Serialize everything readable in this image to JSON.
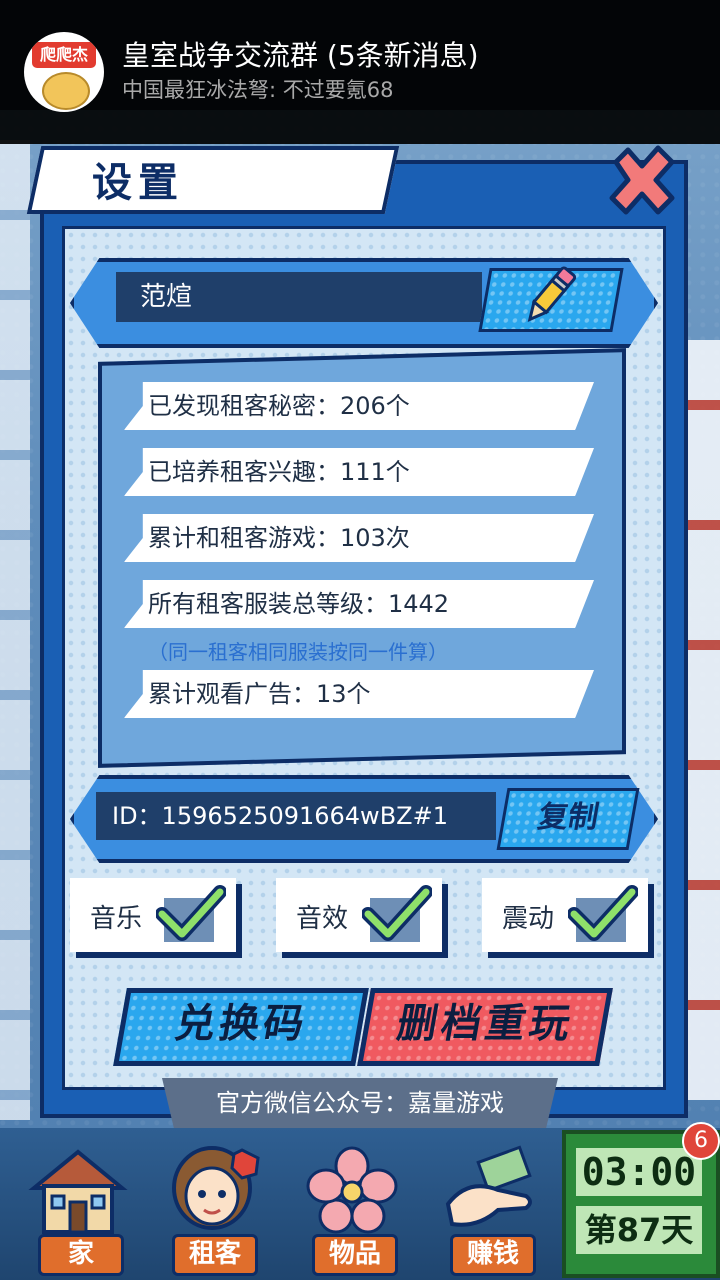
{
  "notification": {
    "avatar_text": "爬爬杰",
    "title": "皇室战争交流群 (5条新消息)",
    "message": "中国最狂冰法弩: 不过要氪68"
  },
  "dialog": {
    "title": "设置",
    "player_name": "范煊",
    "stats": [
      "已发现租客秘密：206个",
      "已培养租客兴趣：111个",
      "累计和租客游戏：103次",
      "所有租客服装总等级：1442",
      "累计观看广告：13个"
    ],
    "stats_note": "（同一租客相同服装按同一件算）",
    "id_text": "ID：1596525091664wBZ#1",
    "copy_label": "复制",
    "toggles": [
      {
        "label": "音乐",
        "checked": true
      },
      {
        "label": "音效",
        "checked": true
      },
      {
        "label": "震动",
        "checked": true
      }
    ],
    "redeem_label": "兑换码",
    "reset_label": "删档重玩",
    "wechat_text": "官方微信公众号：嘉量游戏"
  },
  "bottom_nav": {
    "items": [
      "家",
      "租客",
      "物品",
      "赚钱"
    ],
    "clock_time": "03:00",
    "clock_day": "第87天",
    "badge": "6"
  },
  "colors": {
    "dialog_blue": "#1a5fb4",
    "button_blue": "#2aa7ee",
    "button_red": "#f05a60",
    "dark_outline": "#0d2d66"
  }
}
